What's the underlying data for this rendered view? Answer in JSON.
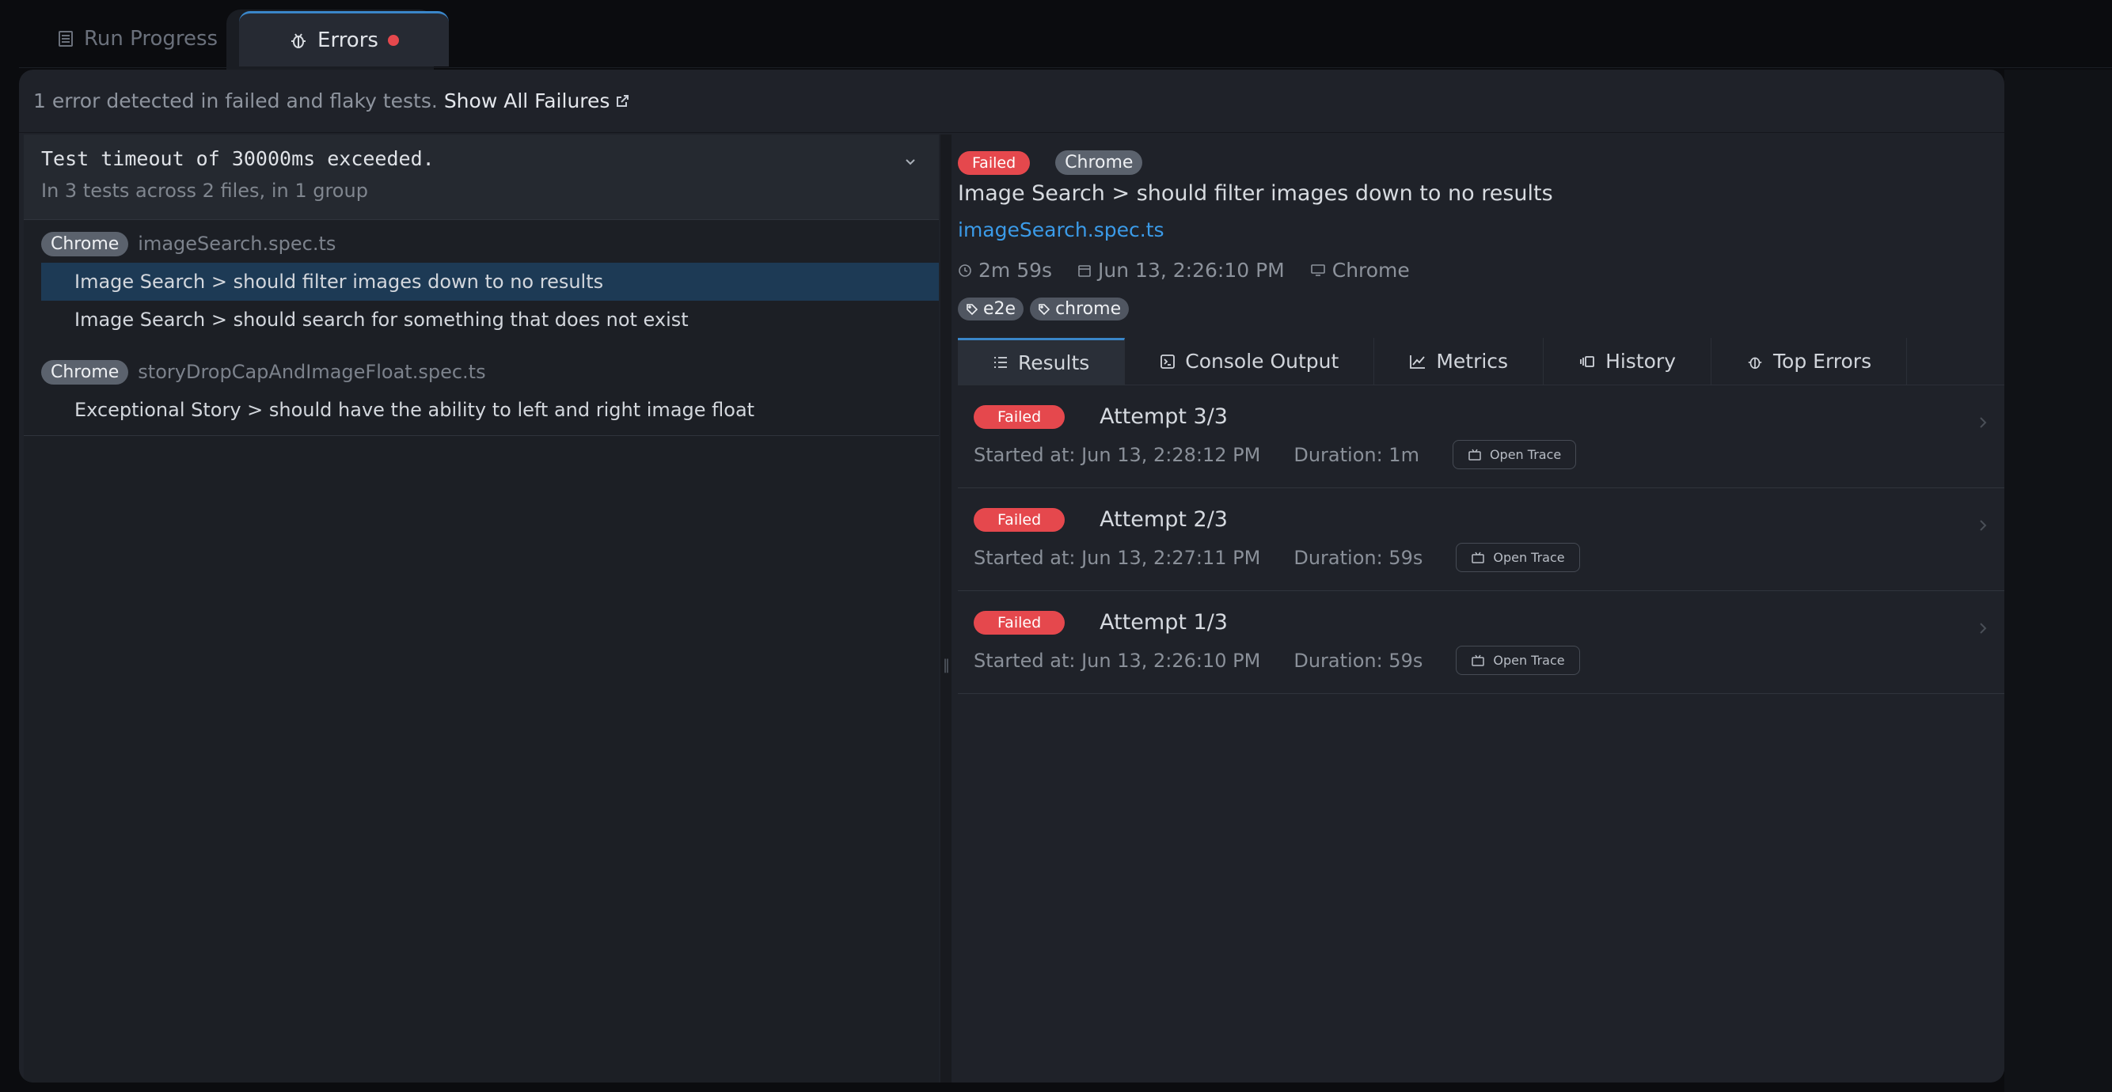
{
  "top_tabs": {
    "run_progress": "Run Progress",
    "errors": "Errors"
  },
  "summary": {
    "text": "1 error detected in failed and flaky tests.",
    "link": "Show All Failures"
  },
  "error_group": {
    "title": "Test timeout of 30000ms exceeded.",
    "subtitle": "In 3 tests across 2 files, in 1 group",
    "files": [
      {
        "browser": "Chrome",
        "name": "imageSearch.spec.ts",
        "tests": [
          "Image Search > should filter images down to no results",
          "Image Search > should search for something that does not exist"
        ]
      },
      {
        "browser": "Chrome",
        "name": "storyDropCapAndImageFloat.spec.ts",
        "tests": [
          "Exceptional Story > should have the ability to left and right image float"
        ]
      }
    ]
  },
  "detail": {
    "status": "Failed",
    "browser": "Chrome",
    "title": "Image Search > should filter images down to no results",
    "file": "imageSearch.spec.ts",
    "duration": "2m 59s",
    "date": "Jun 13, 2:26:10 PM",
    "platform": "Chrome",
    "tags": [
      "e2e",
      "chrome"
    ]
  },
  "tabs": [
    "Results",
    "Console Output",
    "Metrics",
    "History",
    "Top Errors"
  ],
  "attempts": [
    {
      "status": "Failed",
      "title": "Attempt 3/3",
      "started": "Started at: Jun 13, 2:28:12 PM",
      "duration": "Duration: 1m",
      "trace": "Open Trace"
    },
    {
      "status": "Failed",
      "title": "Attempt 2/3",
      "started": "Started at: Jun 13, 2:27:11 PM",
      "duration": "Duration: 59s",
      "trace": "Open Trace"
    },
    {
      "status": "Failed",
      "title": "Attempt 1/3",
      "started": "Started at: Jun 13, 2:26:10 PM",
      "duration": "Duration: 59s",
      "trace": "Open Trace"
    }
  ],
  "colors": {
    "accent": "#3a86c9",
    "failed": "#e5484d",
    "link": "#3b9be8",
    "selected_row": "#1d3a55"
  }
}
